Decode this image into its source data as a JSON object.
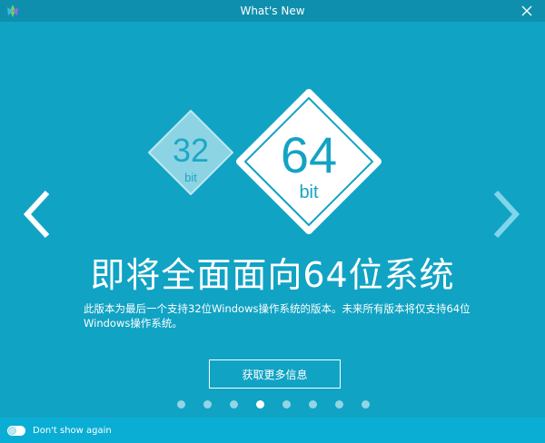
{
  "window": {
    "title": "What's New"
  },
  "hero": {
    "old_number": "32",
    "old_unit": "bit",
    "new_number": "64",
    "new_unit": "bit"
  },
  "headline": "即将全面面向64位系统",
  "description": "此版本为最后一个支持32位Windows操作系统的版本。未来所有版本将仅支持64位Windows操作系统。",
  "more_button_label": "获取更多信息",
  "pager": {
    "total": 8,
    "active_index": 3
  },
  "footer": {
    "toggle_label": "Don't show again"
  },
  "colors": {
    "background": "#11a3c4",
    "titlebar": "#0f8fae",
    "footer": "#0aaed4",
    "accent_white": "#ffffff"
  },
  "icons": {
    "app": "app-logo-icon",
    "close": "close-icon",
    "prev": "chevron-left-icon",
    "next": "chevron-right-icon"
  }
}
